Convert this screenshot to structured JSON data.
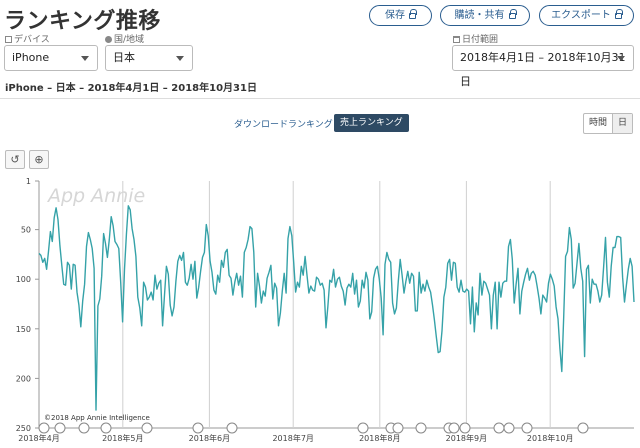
{
  "header": {
    "title": "ランキング推移",
    "buttons": {
      "save": "保存",
      "share": "購読・共有",
      "export": "エクスポート"
    }
  },
  "filters": {
    "device": {
      "label": "デバイス",
      "value": "iPhone"
    },
    "country": {
      "label": "国/地域",
      "value": "日本"
    },
    "date": {
      "label": "日付範囲",
      "value": "2018年4月1日 – 2018年10月31日"
    }
  },
  "subtitle": "iPhone – 日本 – 2018年4月1日 – 2018年10月31日",
  "tabs": {
    "downloads": "ダウンロードランキング",
    "revenue": "売上ランキング"
  },
  "granularity": {
    "hourly": "時間",
    "daily": "日"
  },
  "icons": {
    "reset": "reset-icon",
    "zoom": "zoom-icon",
    "lock": "lock-icon"
  },
  "colors": {
    "accent": "#2a5d8f",
    "series": "#35a2a8",
    "active_tab": "#2e4a64"
  },
  "watermark": "App Annie",
  "copyright": "©2018 App Annie Intelligence",
  "chart_data": {
    "type": "line",
    "title": "",
    "xlabel": "",
    "ylabel": "",
    "y_inverted": true,
    "ylim": [
      1,
      250
    ],
    "y_ticks": [
      1,
      50,
      100,
      150,
      200,
      250
    ],
    "x_ticks": [
      "2018年4月",
      "2018年5月",
      "2018年6月",
      "2018年7月",
      "2018年8月",
      "2018年9月",
      "2018年10月"
    ],
    "xlim": [
      "2018-04-01",
      "2018-10-31"
    ],
    "grid": "vertical",
    "series": [
      {
        "values": [
          74,
          76,
          83,
          79,
          90,
          72,
          52,
          62,
          38,
          28,
          40,
          66,
          86,
          105,
          106,
          83,
          86,
          110,
          85,
          86,
          113,
          126,
          148,
          122,
          105,
          67,
          53,
          60,
          69,
          89,
          232,
          127,
          120,
          97,
          54,
          64,
          78,
          60,
          37,
          46,
          62,
          65,
          69,
          103,
          143,
          90,
          55,
          26,
          30,
          49,
          60,
          77,
          118,
          129,
          147,
          103,
          108,
          121,
          118,
          113,
          121,
          96,
          110,
          104,
          101,
          147,
          116,
          87,
          95,
          126,
          137,
          128,
          102,
          82,
          76,
          81,
          73,
          103,
          106,
          99,
          85,
          100,
          82,
          119,
          108,
          92,
          78,
          73,
          45,
          56,
          82,
          93,
          111,
          115,
          96,
          103,
          81,
          88,
          73,
          70,
          96,
          99,
          116,
          103,
          94,
          106,
          97,
          118,
          73,
          68,
          60,
          47,
          49,
          73,
          128,
          94,
          107,
          124,
          112,
          117,
          99,
          93,
          86,
          120,
          104,
          109,
          147,
          134,
          112,
          94,
          114,
          59,
          47,
          56,
          83,
          113,
          103,
          108,
          87,
          96,
          77,
          96,
          114,
          107,
          111,
          112,
          98,
          100,
          106,
          104,
          111,
          149,
          127,
          101,
          103,
          90,
          108,
          100,
          98,
          107,
          112,
          126,
          109,
          105,
          108,
          94,
          115,
          101,
          128,
          122,
          101,
          109,
          93,
          101,
          140,
          133,
          99,
          90,
          87,
          100,
          119,
          156,
          85,
          73,
          80,
          83,
          124,
          135,
          129,
          102,
          80,
          96,
          114,
          102,
          92,
          104,
          94,
          97,
          132,
          132,
          93,
          114,
          105,
          112,
          101,
          108,
          113,
          126,
          141,
          158,
          174,
          173,
          152,
          118,
          108,
          84,
          80,
          101,
          83,
          84,
          108,
          113,
          101,
          112,
          113,
          110,
          112,
          145,
          108,
          153,
          124,
          136,
          94,
          116,
          102,
          104,
          110,
          116,
          150,
          116,
          103,
          150,
          103,
          118,
          104,
          102,
          102,
          67,
          60,
          80,
          124,
          105,
          89,
          135,
          112,
          103,
          95,
          89,
          101,
          94,
          92,
          96,
          107,
          119,
          135,
          116,
          119,
          123,
          104,
          95,
          100,
          107,
          128,
          140,
          170,
          193,
          138,
          77,
          72,
          48,
          60,
          109,
          104,
          84,
          64,
          89,
          102,
          178,
          90,
          86,
          124,
          100,
          105,
          105,
          112,
          123,
          116,
          88,
          58,
          103,
          118,
          87,
          68,
          68,
          57,
          57,
          58,
          98,
          123,
          106,
          90,
          79,
          87,
          123
        ]
      }
    ]
  }
}
